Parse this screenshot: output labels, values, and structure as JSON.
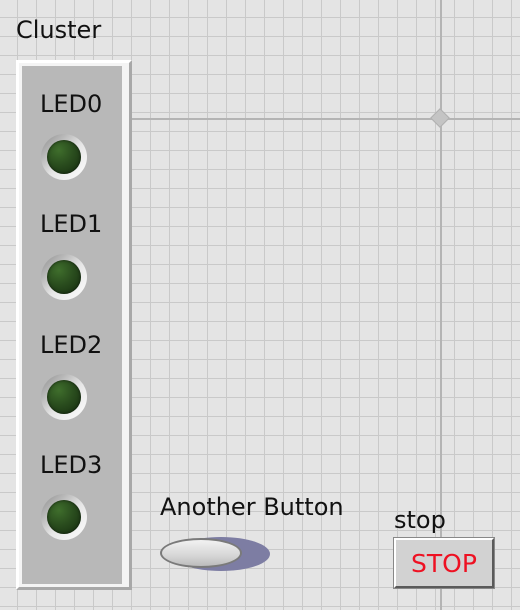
{
  "cluster": {
    "label": "Cluster",
    "leds": [
      {
        "label": "LED0",
        "state": "off"
      },
      {
        "label": "LED1",
        "state": "off"
      },
      {
        "label": "LED2",
        "state": "off"
      },
      {
        "label": "LED3",
        "state": "off"
      }
    ]
  },
  "another_button": {
    "label": "Another Button",
    "state": "off"
  },
  "stop": {
    "label": "stop",
    "button_text": "STOP",
    "text_color": "#ee1122"
  },
  "colors": {
    "panel_background": "#e4e4e4",
    "grid": "#c9c9c9",
    "cluster_background": "#b8b8b8",
    "led_off": "#2a4d1e"
  }
}
